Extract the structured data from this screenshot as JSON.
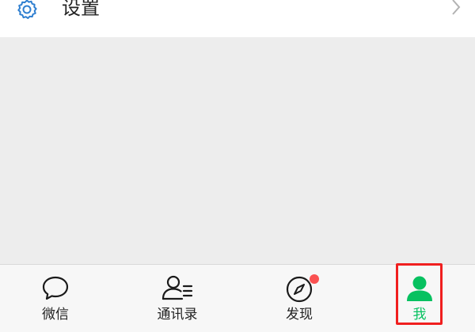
{
  "settings_row": {
    "icon": "gear-icon",
    "label": "设置",
    "chevron": "chevron-right-icon"
  },
  "tabbar": {
    "tabs": [
      {
        "id": "chats",
        "label": "微信",
        "icon": "chat-bubble-icon",
        "active": false,
        "badge": false
      },
      {
        "id": "contacts",
        "label": "通讯录",
        "icon": "contacts-icon",
        "active": false,
        "badge": false
      },
      {
        "id": "discover",
        "label": "发现",
        "icon": "compass-icon",
        "active": false,
        "badge": true
      },
      {
        "id": "me",
        "label": "我",
        "icon": "person-icon",
        "active": true,
        "badge": false
      }
    ]
  },
  "colors": {
    "accent": "#07c160",
    "badge": "#fa5151",
    "highlight": "#f01f1f",
    "icon_blue": "#2f7fd0",
    "text": "#222222",
    "background": "#ededed"
  }
}
